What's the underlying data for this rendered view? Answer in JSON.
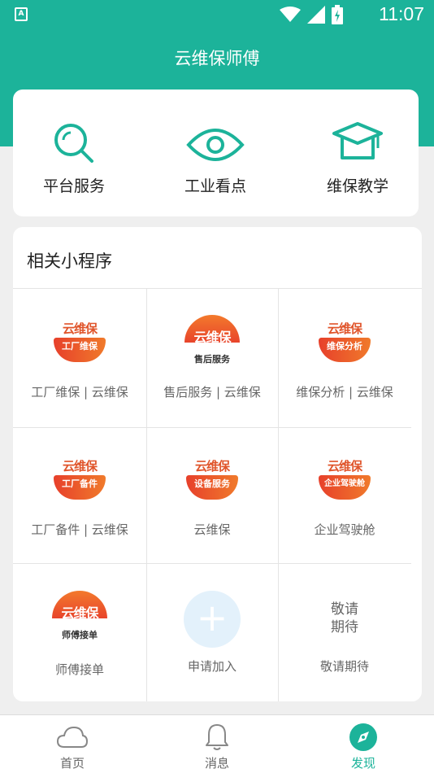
{
  "status_bar": {
    "time": "11:07",
    "notification_label": "A"
  },
  "header": {
    "title": "云维保师傅"
  },
  "quick_links": [
    {
      "label": "平台服务",
      "icon": "search-icon"
    },
    {
      "label": "工业看点",
      "icon": "eye-icon"
    },
    {
      "label": "维保教学",
      "icon": "graduation-cap-icon"
    }
  ],
  "mini_programs": {
    "section_title": "相关小程序",
    "items": [
      {
        "caption": "工厂维保 | 云维保",
        "logo_brand": "云维保",
        "logo_sub": "工厂维保"
      },
      {
        "caption": "售后服务 | 云维保",
        "logo_brand": "云维保",
        "logo_sub": "售后服务"
      },
      {
        "caption": "维保分析 | 云维保",
        "logo_brand": "云维保",
        "logo_sub": "维保分析"
      },
      {
        "caption": "工厂备件 | 云维保",
        "logo_brand": "云维保",
        "logo_sub": "工厂备件"
      },
      {
        "caption": "云维保",
        "logo_brand": "云维保",
        "logo_sub": "设备服务"
      },
      {
        "caption": "企业驾驶舱",
        "logo_brand": "云维保",
        "logo_sub": "企业驾驶舱"
      },
      {
        "caption": "师傅接单",
        "logo_brand": "云维保",
        "logo_sub": "师傅接单"
      },
      {
        "caption": "申请加入",
        "icon": "plus-icon"
      },
      {
        "caption": "敬请期待",
        "placeholder_text_line1": "敬请",
        "placeholder_text_line2": "期待"
      }
    ]
  },
  "tab_bar": {
    "tabs": [
      {
        "label": "首页",
        "icon": "cloud-icon",
        "active": false
      },
      {
        "label": "消息",
        "icon": "bell-icon",
        "active": false
      },
      {
        "label": "发现",
        "icon": "compass-icon",
        "active": true
      }
    ]
  },
  "colors": {
    "brand": "#1cb39a",
    "logo_orange": "#e8442b",
    "background": "#efefef"
  }
}
